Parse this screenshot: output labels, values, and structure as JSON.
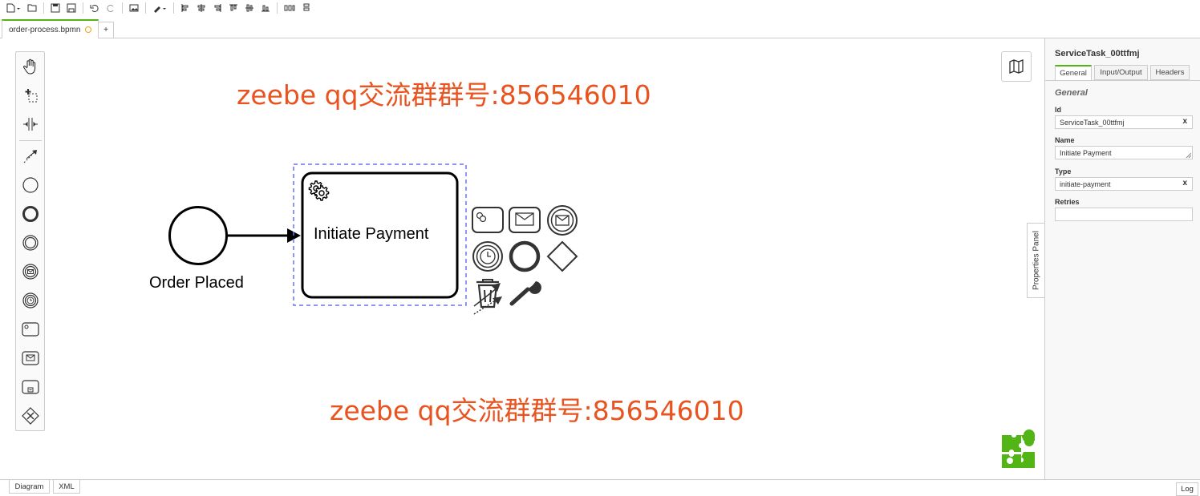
{
  "toolbar": {
    "buttons": [
      "new-file-icon",
      "open-file-icon",
      "save-icon",
      "save-as-icon",
      "undo-icon",
      "redo-icon",
      "export-image-icon",
      "color-picker-icon",
      "align-left-icon",
      "align-center-icon",
      "align-right-icon",
      "align-top-icon",
      "align-middle-icon",
      "align-bottom-icon",
      "distribute-horizontal-icon",
      "distribute-vertical-icon"
    ]
  },
  "tabs": {
    "file_name": "order-process.bpmn",
    "add_label": "+"
  },
  "watermarks": [
    "zeebe qq交流群群号:856546010",
    "zeebe qq交流群群号:856546010"
  ],
  "diagram": {
    "start_event_label": "Order Placed",
    "task_label": "Initiate Payment"
  },
  "properties_panel": {
    "toggle_label": "Properties Panel",
    "title": "ServiceTask_00ttfmj",
    "tabs": [
      "General",
      "Input/Output",
      "Headers"
    ],
    "group_title": "General",
    "fields": {
      "id_label": "Id",
      "id_value": "ServiceTask_00ttfmj",
      "name_label": "Name",
      "name_value": "Initiate Payment",
      "type_label": "Type",
      "type_value": "initiate-payment",
      "retries_label": "Retries",
      "retries_value": ""
    },
    "clear_symbol": "x"
  },
  "bottom": {
    "tabs": [
      "Diagram",
      "XML"
    ],
    "log_label": "Log"
  },
  "colors": {
    "accent": "#52b415",
    "watermark": "#e8531f",
    "selection": "#4d90fe"
  }
}
